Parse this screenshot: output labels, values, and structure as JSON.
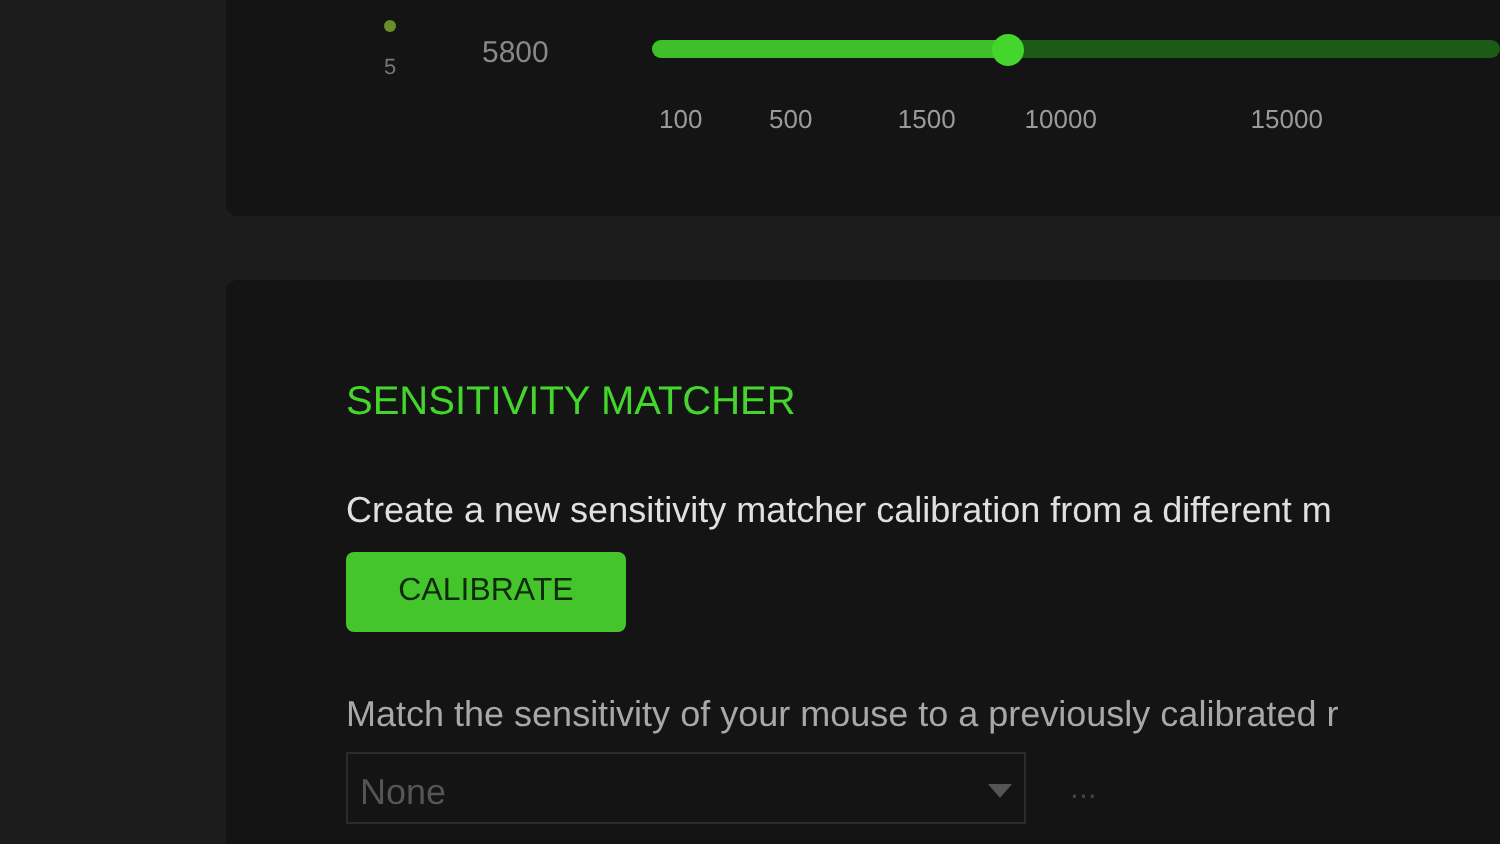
{
  "dpi_stage": {
    "number": "5",
    "active": true,
    "value": "5800",
    "level": 0.42,
    "ticks": [
      "100",
      "500",
      "1500",
      "10000",
      "15000"
    ]
  },
  "sensitivity_matcher": {
    "title": "SENSITIVITY MATCHER",
    "create_text": "Create a new sensitivity matcher calibration from a different m",
    "calibrate_button": "CALIBRATE",
    "match_text": "Match the sensitivity of your mouse to a previously calibrated r",
    "dropdown": {
      "value": "None"
    },
    "more_button": "..."
  }
}
